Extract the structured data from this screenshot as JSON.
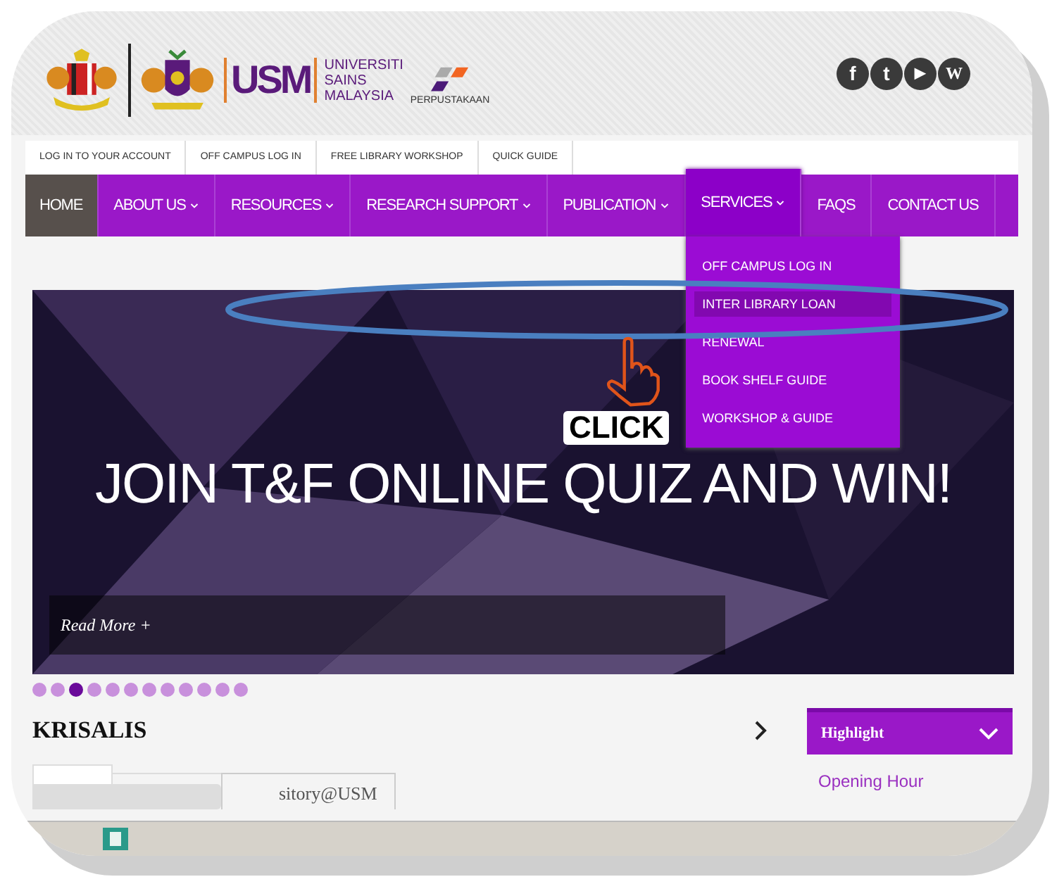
{
  "header": {
    "logo_letters": "USM",
    "university": [
      "UNIVERSITI",
      "SAINS",
      "MALAYSIA"
    ],
    "library": "PERPUSTAKAAN",
    "social": [
      {
        "kind": "facebook",
        "label": "f"
      },
      {
        "kind": "twitter",
        "label": "t"
      },
      {
        "kind": "youtube",
        "label": "▶"
      },
      {
        "kind": "wiki",
        "label": "W"
      }
    ]
  },
  "top_links": [
    "LOG IN TO YOUR ACCOUNT",
    "OFF CAMPUS LOG IN",
    "FREE LIBRARY WORKSHOP",
    "QUICK GUIDE"
  ],
  "nav": [
    {
      "label": "HOME",
      "selected": true,
      "caret": false,
      "expanded": false
    },
    {
      "label": "ABOUT US",
      "selected": false,
      "caret": true,
      "expanded": false
    },
    {
      "label": "RESOURCES",
      "selected": false,
      "caret": true,
      "expanded": false
    },
    {
      "label": "RESEARCH SUPPORT",
      "selected": false,
      "caret": true,
      "expanded": false
    },
    {
      "label": "PUBLICATION",
      "selected": false,
      "caret": true,
      "expanded": false
    },
    {
      "label": "SERVICES",
      "selected": false,
      "caret": true,
      "expanded": true
    },
    {
      "label": "FAQS",
      "selected": false,
      "caret": false,
      "expanded": false
    },
    {
      "label": "CONTACT US",
      "selected": false,
      "caret": false,
      "expanded": false
    }
  ],
  "dropdown": [
    {
      "label": "OFF CAMPUS LOG IN",
      "selected": false
    },
    {
      "label": "INTER LIBRARY LOAN",
      "selected": true
    },
    {
      "label": "RENEWAL",
      "selected": false
    },
    {
      "label": "BOOK SHELF GUIDE",
      "selected": false
    },
    {
      "label": "WORKSHOP & GUIDE",
      "selected": false
    }
  ],
  "banner": {
    "headline": "JOIN T&F ONLINE QUIZ AND WIN!",
    "read_more": "Read More +"
  },
  "slider_dots": [
    {
      "selected": false
    },
    {
      "selected": false
    },
    {
      "selected": true
    },
    {
      "selected": false
    },
    {
      "selected": false
    },
    {
      "selected": false
    },
    {
      "selected": false
    },
    {
      "selected": false
    },
    {
      "selected": false
    },
    {
      "selected": false
    },
    {
      "selected": false
    },
    {
      "selected": false
    }
  ],
  "section": {
    "title": "KRISALIS",
    "tab_text": "sitory@USM"
  },
  "sidebar": {
    "title": "Highlight",
    "links": [
      "Opening Hour"
    ]
  },
  "annotation": {
    "label": "CLICK"
  }
}
